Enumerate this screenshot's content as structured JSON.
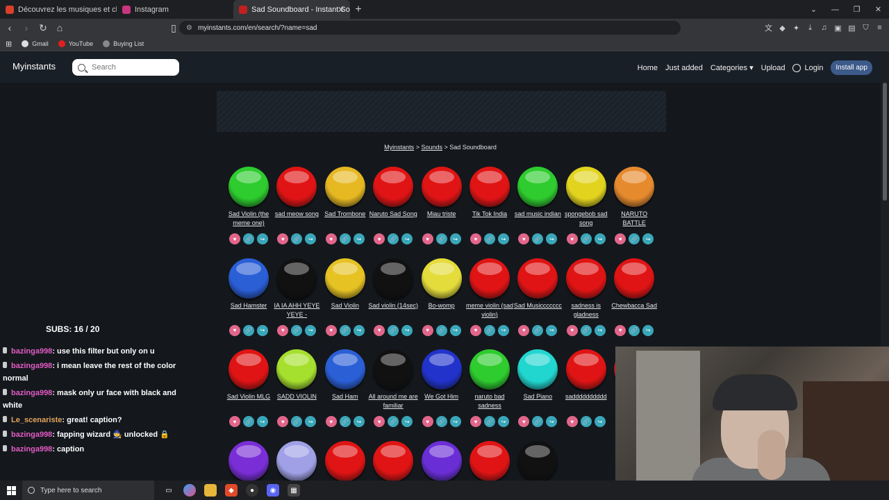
{
  "browser": {
    "tabs": [
      {
        "title": "Découvrez les musiques et chansons",
        "color": "#d9402b",
        "active": false
      },
      {
        "title": "Instagram",
        "color": "#c93580",
        "active": false
      },
      {
        "title": "Sad Soundboard - Instant So",
        "color": "#c02020",
        "active": true
      }
    ],
    "url": "myinstants.com/en/search/?name=sad",
    "bookmarks": [
      {
        "label": "Gmail",
        "color": "#dddddd"
      },
      {
        "label": "YouTube",
        "color": "#e02020"
      },
      {
        "label": "Buying List",
        "color": "#888888"
      }
    ]
  },
  "site": {
    "brand": "Myinstants",
    "search_placeholder": "Search",
    "nav": {
      "home": "Home",
      "just_added": "Just added",
      "categories": "Categories ▾",
      "upload": "Upload",
      "login": "Login",
      "install": "Install app"
    },
    "breadcrumb": {
      "home": "Myinstants",
      "sounds": "Sounds",
      "current": "Sad Soundboard"
    }
  },
  "sounds": [
    {
      "label": "Sad Violin (the meme one)",
      "color": "#2ecc2e"
    },
    {
      "label": "sad meow song",
      "color": "#e01414"
    },
    {
      "label": "Sad Trombone",
      "color": "#e6b822"
    },
    {
      "label": "Naruto Sad Song",
      "color": "#e01414"
    },
    {
      "label": "Miau triste",
      "color": "#e01414"
    },
    {
      "label": "Tik Tok India",
      "color": "#e01414"
    },
    {
      "label": "sad music indian",
      "color": "#2ecc2e"
    },
    {
      "label": "spongebob sad song",
      "color": "#e2d41e"
    },
    {
      "label": "NARUTO BATTLE",
      "color": "#e68a2e"
    },
    {
      "label": "Sad Hamster",
      "color": "#2a5fd6"
    },
    {
      "label": "IA IA AHH YEYE YEYE -",
      "color": "#111111"
    },
    {
      "label": "Sad Violin",
      "color": "#e6c222"
    },
    {
      "label": "Sad violin (14sec)",
      "color": "#111111"
    },
    {
      "label": "Bo-womp",
      "color": "#e4dc3a"
    },
    {
      "label": "meme violin (sad violin)",
      "color": "#e01414"
    },
    {
      "label": "Sad Musiccccccc",
      "color": "#e01414"
    },
    {
      "label": "sadness is gladness",
      "color": "#e01414"
    },
    {
      "label": "Chewbacca Sad",
      "color": "#e01414"
    },
    {
      "label": "Sad Violin MLG",
      "color": "#e01414"
    },
    {
      "label": "SADD VIOLIN",
      "color": "#a6e02e"
    },
    {
      "label": "Sad Ham",
      "color": "#2a5fd6"
    },
    {
      "label": "All around me are familiar",
      "color": "#111111"
    },
    {
      "label": "We Got Him",
      "color": "#2233cc"
    },
    {
      "label": "naruto bad sadness",
      "color": "#2ecc2e"
    },
    {
      "label": "Sad Piano",
      "color": "#22d6d0"
    },
    {
      "label": "sadddddddddd",
      "color": "#e01414"
    },
    {
      "label": "",
      "color": "#e01414"
    },
    {
      "label": "",
      "color": "#7a2ed6"
    },
    {
      "label": "",
      "color": "#a0a0e6"
    },
    {
      "label": "",
      "color": "#e01414"
    },
    {
      "label": "",
      "color": "#e01414"
    },
    {
      "label": "",
      "color": "#6a2ed6"
    },
    {
      "label": "",
      "color": "#e01414"
    },
    {
      "label": "",
      "color": "#111111"
    }
  ],
  "stream": {
    "subs": "SUBS: 16 / 20",
    "chat": [
      {
        "user": "bazinga998",
        "text": ": use this filter but only on u",
        "alt": false
      },
      {
        "user": "bazinga998",
        "text": ": i mean leave the rest of the color normal",
        "alt": false
      },
      {
        "user": "bazinga998",
        "text": ": mask only ur face with black and white",
        "alt": false
      },
      {
        "user": "Le_scenariste",
        "text": ": great! caption?",
        "alt": true
      },
      {
        "user": "bazinga998",
        "text": ": fapping wizard 🧙 unlocked 🔒",
        "alt": false
      },
      {
        "user": "bazinga998",
        "text": ": caption",
        "alt": false
      }
    ]
  },
  "taskbar": {
    "search_placeholder": "Type here to search"
  }
}
